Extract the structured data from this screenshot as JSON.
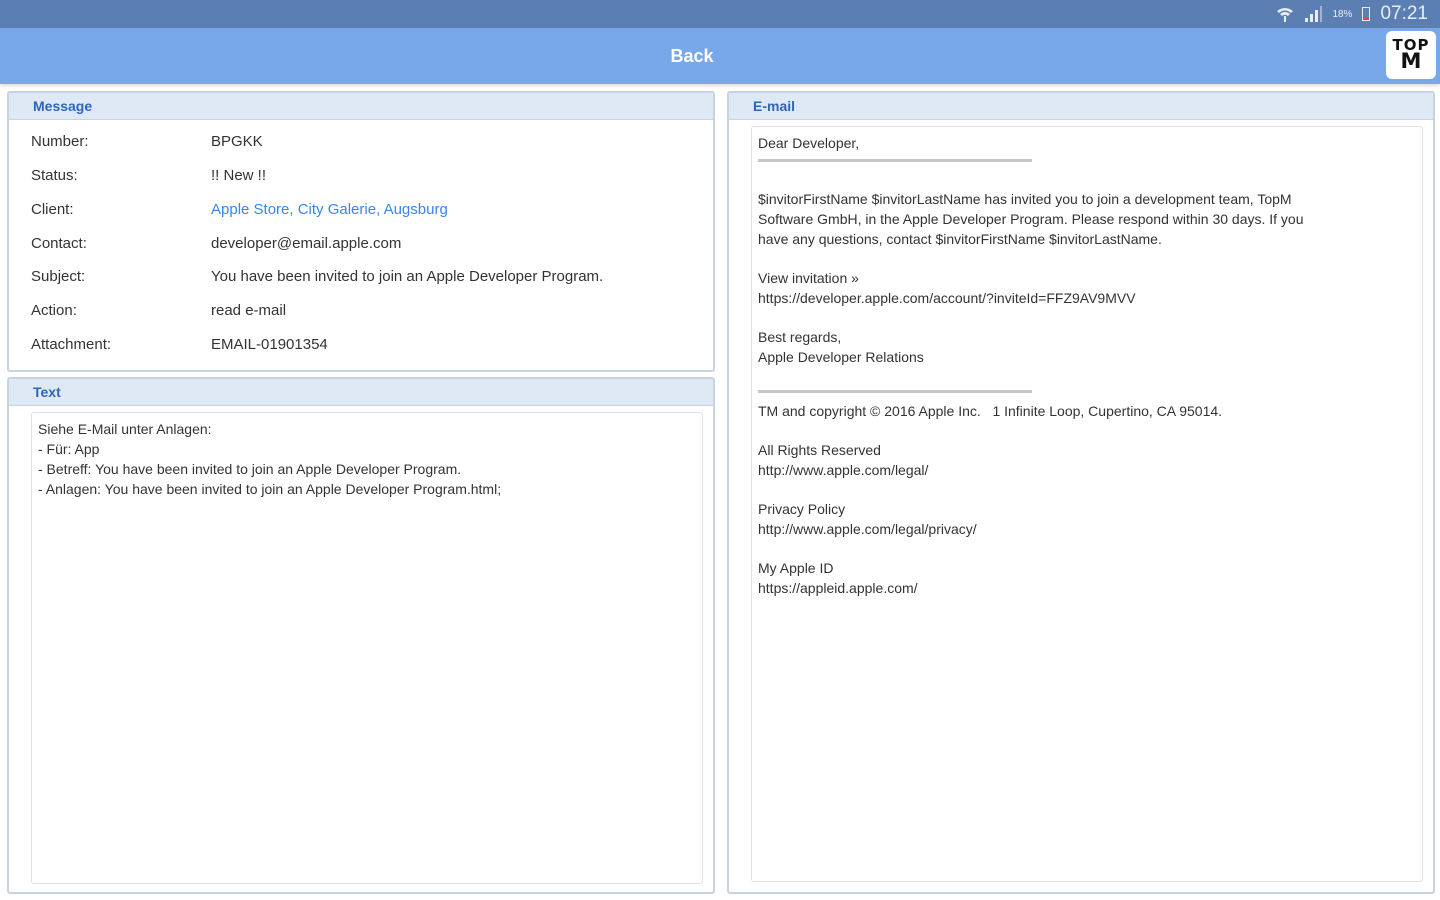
{
  "status_bar": {
    "battery_percent": "18%",
    "time": "07:21",
    "battery_level": 0.18,
    "battery_color": "#e04040",
    "icons": [
      "wifi-icon",
      "signal-icon",
      "battery-icon"
    ]
  },
  "app_bar": {
    "back_label": "Back",
    "logo_line1": "TOP",
    "logo_line2": "M",
    "color": "#79a8ea"
  },
  "message_panel": {
    "title": "Message",
    "fields": [
      {
        "label": "Number:",
        "value": "BPGKK"
      },
      {
        "label": "Status:",
        "value": "!! New !!"
      },
      {
        "label": "Client:",
        "value": "Apple Store, City Galerie, Augsburg"
      },
      {
        "label": "Contact:",
        "value": "developer@email.apple.com"
      },
      {
        "label": "Subject:",
        "value": "You have been invited to join an Apple Developer Program."
      },
      {
        "label": "Action:",
        "value": "read e-mail"
      },
      {
        "label": "Attachment:",
        "value": "EMAIL-01901354"
      }
    ]
  },
  "text_panel": {
    "title": "Text",
    "lines": [
      "Siehe E-Mail unter Anlagen:",
      "- Für: App",
      "- Betreff: You have been invited to join an Apple Developer Program.",
      "- Anlagen: You have been invited to join an Apple Developer Program.html;"
    ]
  },
  "email_panel": {
    "title": "E-mail",
    "greeting": "Dear Developer,",
    "body_lines": [
      "$invitorFirstName $invitorLastName has invited you to join a development team, TopM",
      "Software GmbH, in the Apple Developer Program. Please respond within 30 days. If you",
      "have any questions, contact $invitorFirstName $invitorLastName."
    ],
    "view_invitation": "View invitation »",
    "invitation_url": "https://developer.apple.com/account/?inviteId=FFZ9AV9MVV",
    "regards": "Best regards,",
    "signature": "Apple Developer Relations",
    "copyright": "TM and copyright © 2016 Apple Inc.   1 Infinite Loop, Cupertino, CA 95014.",
    "rights": "All Rights Reserved",
    "rights_url": "http://www.apple.com/legal/",
    "privacy": "Privacy Policy",
    "privacy_url": "http://www.apple.com/legal/privacy/",
    "appleid": "My Apple ID",
    "appleid_url": "https://appleid.apple.com/"
  }
}
